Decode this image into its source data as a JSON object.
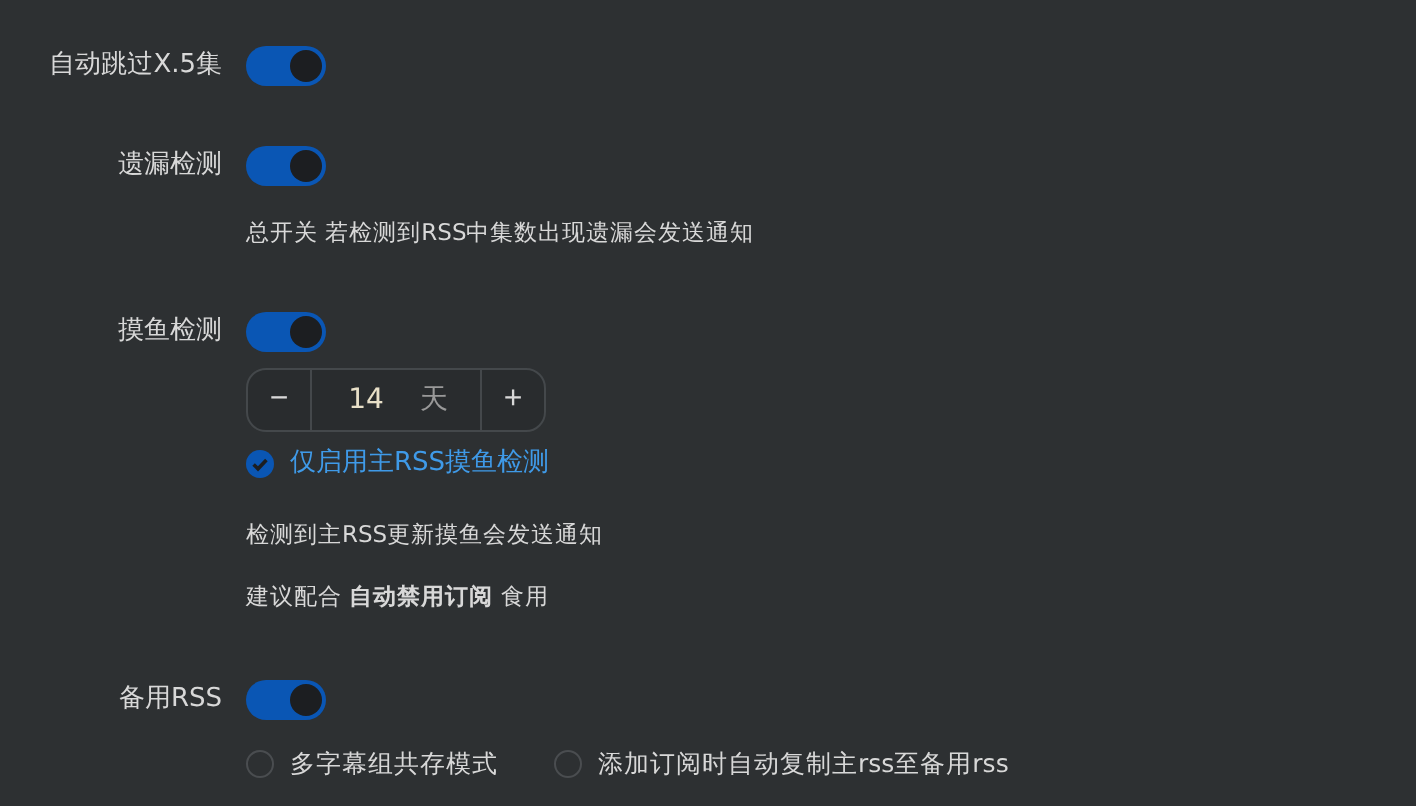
{
  "sections": [
    {
      "label": "自动跳过X.5集",
      "on": true
    },
    {
      "label": "遗漏检测",
      "on": true,
      "items": [
        {
          "kind": "note",
          "text": "总开关 若检测到RSS中集数出现遗漏会发送通知"
        }
      ]
    },
    {
      "label": "摸鱼检测",
      "on": true,
      "items": [
        {
          "kind": "stepper",
          "minus": "−",
          "value": "14",
          "unit": "天",
          "plus": "+"
        },
        {
          "kind": "checkbox",
          "text": "仅启用主RSS摸鱼检测",
          "checked": true
        },
        {
          "kind": "note",
          "text": "检测到主RSS更新摸鱼会发送通知"
        },
        {
          "kind": "note",
          "text": "建议配合 **自动禁用订阅** 食用"
        }
      ]
    },
    {
      "label": "备用RSS",
      "on": true,
      "items": [
        {
          "kind": "radios",
          "options": [
            {
              "text": "多字幕组共存模式",
              "selected": false
            },
            {
              "text": "添加订阅时自动复制主rss至备用rss",
              "selected": false
            }
          ]
        }
      ]
    }
  ]
}
